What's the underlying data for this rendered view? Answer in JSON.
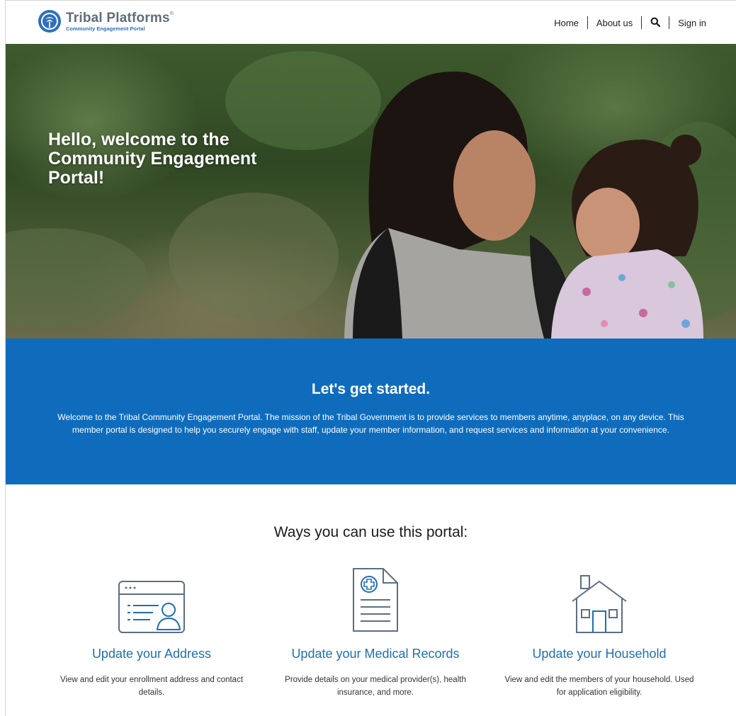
{
  "header": {
    "brand_name": "Tribal Platforms",
    "brand_mark": "®",
    "brand_tagline": "Community Engagement Portal",
    "nav": {
      "home": "Home",
      "about": "About us",
      "search_icon": "search-icon",
      "signin": "Sign in"
    }
  },
  "hero": {
    "title": "Hello, welcome to the Community Engagement Portal!"
  },
  "intro": {
    "title": "Let's get started.",
    "text": "Welcome to the Tribal Community Engagement Portal. The mission of the Tribal Government is to provide services to members anytime, anyplace, on any device. This member portal is designed to help you securely engage with staff, update your member information, and request services and information at your convenience."
  },
  "ways": {
    "title": "Ways you can use this portal:",
    "cards": [
      {
        "icon": "address-card-icon",
        "title": "Update your Address",
        "desc": "View and edit your enrollment address and contact details."
      },
      {
        "icon": "medical-document-icon",
        "title": "Update your Medical Records",
        "desc": "Provide details on your medical provider(s), health insurance, and more."
      },
      {
        "icon": "house-icon",
        "title": "Update your Household",
        "desc": "View and edit the members of your household. Used for application eligibility."
      }
    ]
  },
  "colors": {
    "accent_blue": "#0f6cbd",
    "link_blue": "#1e6fb3",
    "icon_gray": "#5b6f82"
  }
}
